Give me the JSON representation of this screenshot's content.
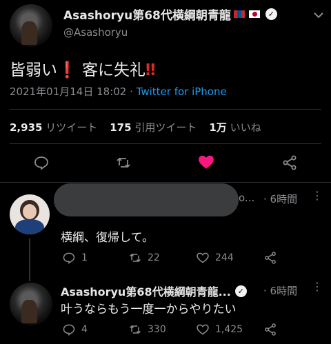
{
  "tweet": {
    "display_name": "Asashoryu第68代横綱朝青龍",
    "handle": "@Asashoryu",
    "text_main": "皆弱い",
    "text_bang1": "❗",
    "text_rest": " 客に失礼",
    "text_bang2": "‼",
    "timestamp": "2021年01月14日 18:02 · ",
    "source": "Twitter for iPhone",
    "retweets_count": "2,935",
    "retweets_label": "リツイート",
    "quotes_count": "175",
    "quotes_label": "引用ツイート",
    "likes_count": "1万",
    "likes_label": "いいね"
  },
  "replies": [
    {
      "name_suffix": "o...",
      "time": "· 6時間",
      "text": "横綱、復帰して。",
      "reply_count": "1",
      "retweet_count": "22",
      "like_count": "244"
    },
    {
      "display_name": "Asashoryu第68代横綱朝青龍...",
      "time": "· 6時間",
      "text": "叶うならもう一度一からやりたい",
      "reply_count": "4",
      "retweet_count": "330",
      "like_count": "1,425"
    }
  ],
  "colors": {
    "background": "#000000",
    "accent_blue": "#1d9bf0",
    "like_pink": "#f91880"
  }
}
